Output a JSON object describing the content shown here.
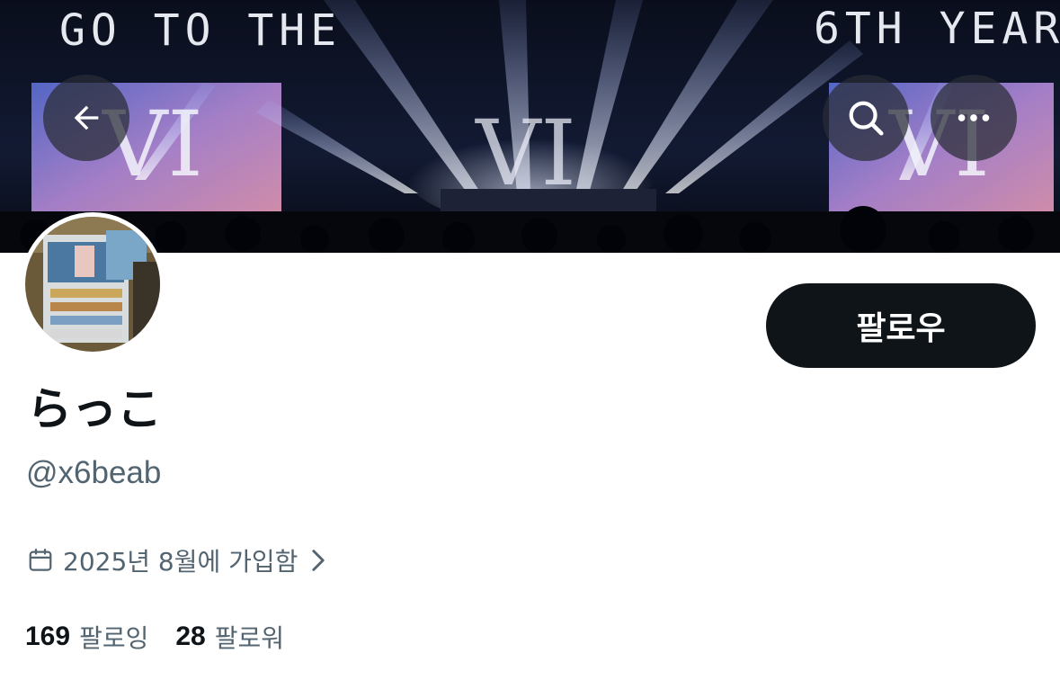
{
  "banner": {
    "text_left": "GO TO THE",
    "text_right": "6TH YEAR",
    "screen_label_left": "VI",
    "screen_label_center": "VI",
    "screen_label_right": "VI"
  },
  "nav": {
    "back_icon": "arrow-left-icon",
    "search_icon": "search-icon",
    "more_icon": "more-horizontal-icon"
  },
  "profile": {
    "display_name": "らっこ",
    "handle": "@x6beab",
    "follow_label": "팔로우",
    "joined_icon": "calendar-icon",
    "joined_text": "2025년 8월에 가입함",
    "joined_chevron": "chevron-right-icon",
    "following_count": "169",
    "following_label": "팔로잉",
    "followers_count": "28",
    "followers_label": "팔로워"
  },
  "colors": {
    "text_primary": "#0f1419",
    "text_secondary": "#536471",
    "follow_bg": "#0f1419",
    "follow_text": "#ffffff"
  }
}
